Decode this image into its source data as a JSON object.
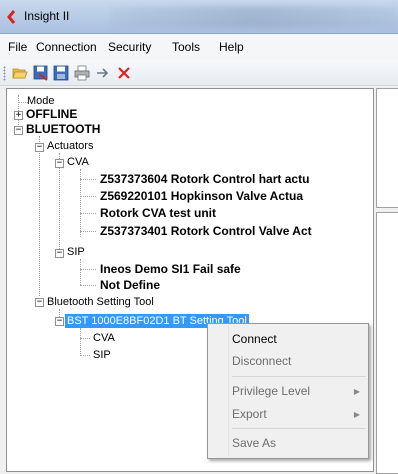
{
  "window": {
    "title": "Insight II"
  },
  "menu": [
    "File",
    "Connection",
    "Security",
    "Tools",
    "Help"
  ],
  "toolbar": {
    "icons": [
      "open-folder-icon",
      "save-report-icon",
      "save-icon",
      "print-icon",
      "forward-arrow-icon",
      "delete-x-icon"
    ],
    "delete_color": "#e0211c"
  },
  "tree": {
    "mode": "Mode",
    "offline": "OFFLINE",
    "bluetooth": "BLUETOOTH",
    "actuators": "Actuators",
    "cva": "CVA",
    "cva_items": [
      "Z537373604 Rotork Control hart actu",
      "Z569220101 Hopkinson Valve Actua",
      "Rotork CVA test unit",
      "Z537373401 Rotork Control Valve Act"
    ],
    "sip": "SIP",
    "sip_items": [
      "Ineos Demo   SI1 Fail safe",
      "Not Define"
    ],
    "bt_tool": "Bluetooth Setting Tool",
    "bst_unit": "BST 1000E8BF02D1 BT Setting Tool",
    "bst_cva": "CVA",
    "bst_sip": "SIP",
    "selection_color": "#3399ff"
  },
  "context_menu": {
    "connect": "Connect",
    "disconnect": "Disconnect",
    "privilege": "Privilege Level",
    "export": "Export",
    "save_as": "Save As"
  }
}
